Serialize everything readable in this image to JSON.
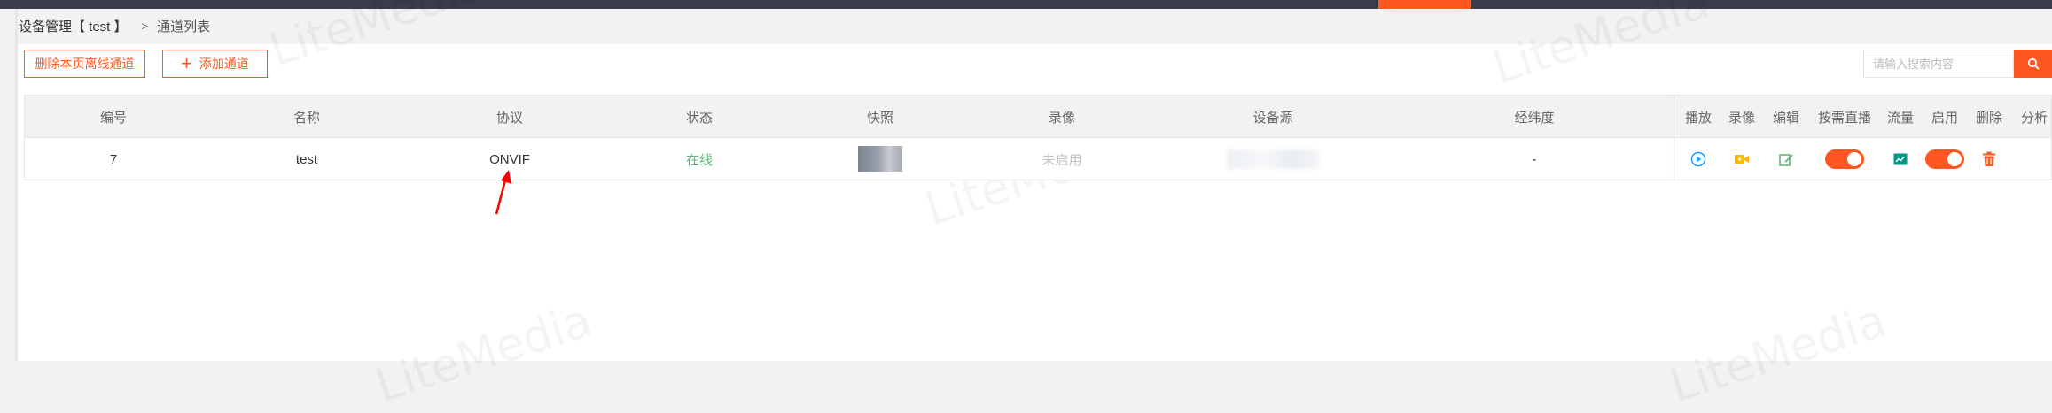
{
  "breadcrumb": {
    "parent": "设备管理【 test 】",
    "separator": ">",
    "current": "通道列表"
  },
  "toolbar": {
    "delete_offline_label": "删除本页离线通道",
    "add_channel_label": "添加通道",
    "add_channel_icon": "plus-icon"
  },
  "search": {
    "placeholder": "请输入搜索内容",
    "button_icon": "search-icon"
  },
  "table": {
    "headers": {
      "id": "编号",
      "name": "名称",
      "protocol": "协议",
      "status": "状态",
      "snapshot": "快照",
      "record": "录像",
      "device_source": "设备源",
      "lnglat": "经纬度",
      "play": "播放",
      "video": "录像",
      "edit": "编辑",
      "on_demand": "按需直播",
      "traffic": "流量",
      "enable": "启用",
      "delete": "删除",
      "analyze": "分析"
    },
    "rows": [
      {
        "id": "7",
        "name": "test",
        "protocol": "ONVIF",
        "status": "在线",
        "record": "未启用",
        "device_source": "",
        "lnglat": "-",
        "on_demand": true,
        "enabled": true
      }
    ]
  },
  "watermark": "LiteMedia",
  "colors": {
    "accent": "#ff5722",
    "online": "#5fb878",
    "play_icon": "#1e9fff",
    "video_icon": "#ffb800",
    "edit_icon": "#5fb878",
    "traffic_icon": "#009688",
    "delete_icon": "#ff5722",
    "annotation_arrow": "#ff0000"
  }
}
